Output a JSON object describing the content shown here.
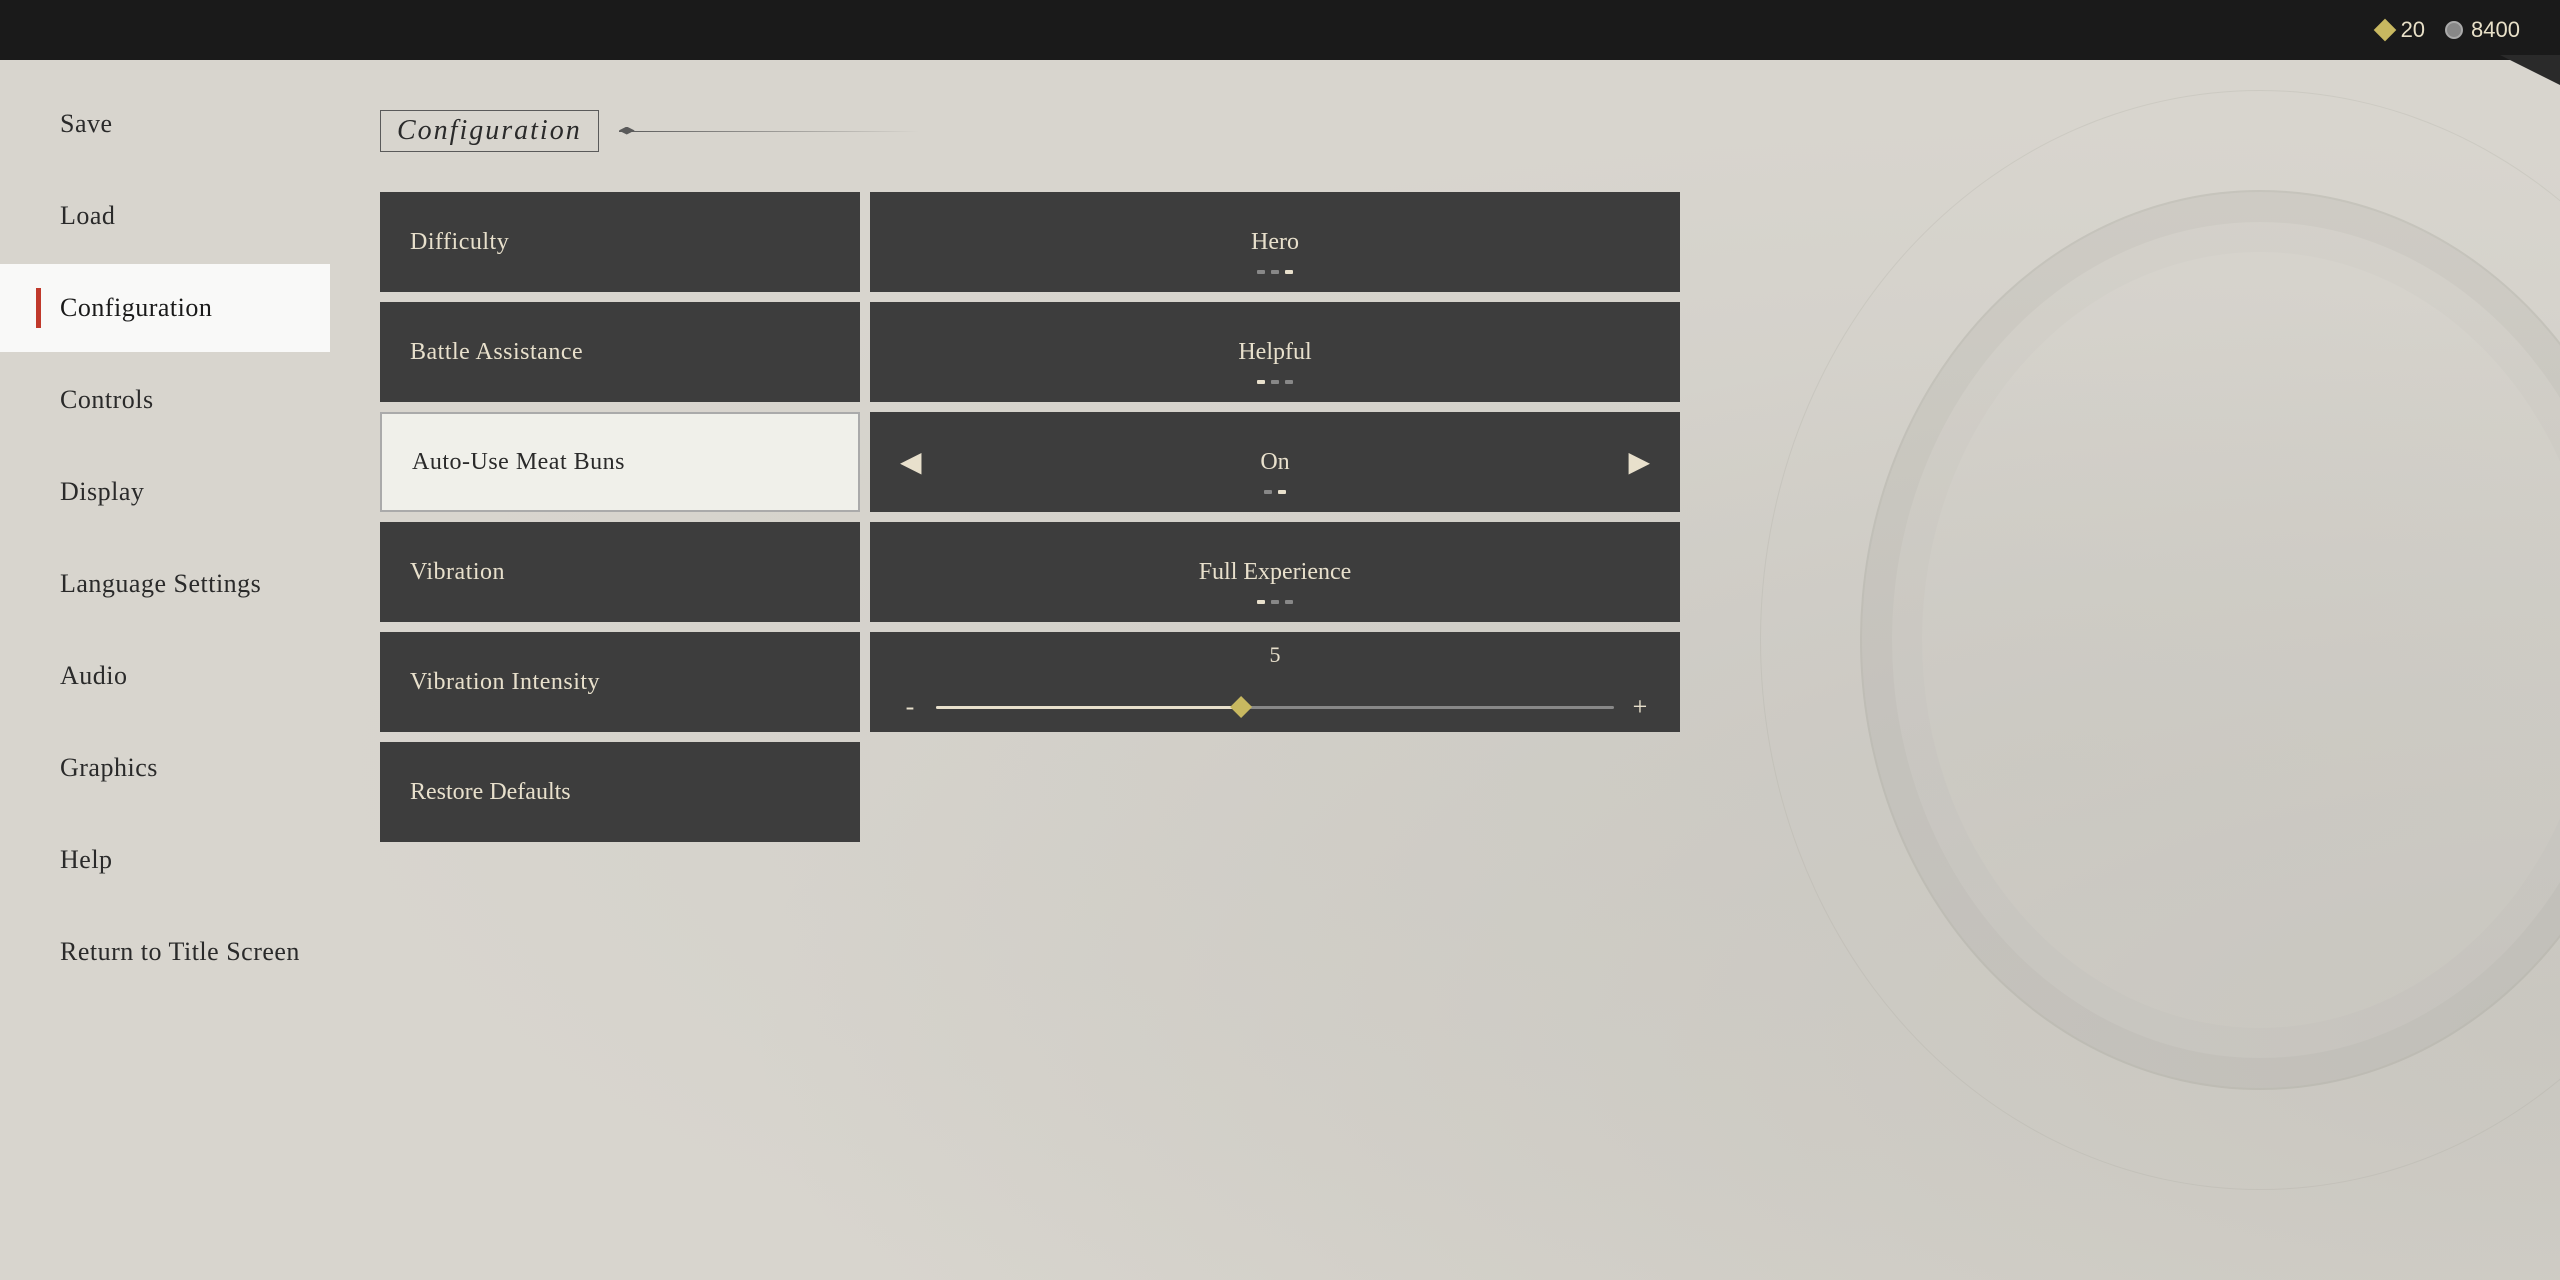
{
  "topbar": {
    "diamond_currency": "20",
    "circle_currency": "8400"
  },
  "sidebar": {
    "items": [
      {
        "id": "save",
        "label": "Save",
        "active": false
      },
      {
        "id": "load",
        "label": "Load",
        "active": false
      },
      {
        "id": "configuration",
        "label": "Configuration",
        "active": true
      },
      {
        "id": "controls",
        "label": "Controls",
        "active": false
      },
      {
        "id": "display",
        "label": "Display",
        "active": false
      },
      {
        "id": "language-settings",
        "label": "Language Settings",
        "active": false
      },
      {
        "id": "audio",
        "label": "Audio",
        "active": false
      },
      {
        "id": "graphics",
        "label": "Graphics",
        "active": false
      },
      {
        "id": "help",
        "label": "Help",
        "active": false
      },
      {
        "id": "return-to-title",
        "label": "Return to Title Screen",
        "active": false
      }
    ]
  },
  "main": {
    "title": "Configuration",
    "settings": [
      {
        "id": "difficulty",
        "label": "Difficulty",
        "value": "Hero",
        "has_arrows": false,
        "has_indicators": true,
        "indicators": [
          {
            "active": false
          },
          {
            "active": false
          },
          {
            "active": true
          }
        ],
        "active_row": false
      },
      {
        "id": "battle-assistance",
        "label": "Battle Assistance",
        "value": "Helpful",
        "has_arrows": false,
        "has_indicators": true,
        "indicators": [
          {
            "active": true
          },
          {
            "active": false
          },
          {
            "active": false
          }
        ],
        "active_row": false
      },
      {
        "id": "auto-use-meat-buns",
        "label": "Auto-Use Meat Buns",
        "value": "On",
        "has_arrows": true,
        "has_indicators": true,
        "indicators": [
          {
            "active": false
          },
          {
            "active": true
          }
        ],
        "active_row": true
      },
      {
        "id": "vibration",
        "label": "Vibration",
        "value": "Full Experience",
        "has_arrows": false,
        "has_indicators": true,
        "indicators": [
          {
            "active": true
          },
          {
            "active": false
          },
          {
            "active": false
          }
        ],
        "active_row": false
      },
      {
        "id": "vibration-intensity",
        "label": "Vibration Intensity",
        "value": "5",
        "has_slider": true,
        "slider_percent": 45,
        "slider_minus": "-",
        "slider_plus": "+",
        "active_row": false
      }
    ],
    "restore_defaults_label": "Restore Defaults"
  }
}
